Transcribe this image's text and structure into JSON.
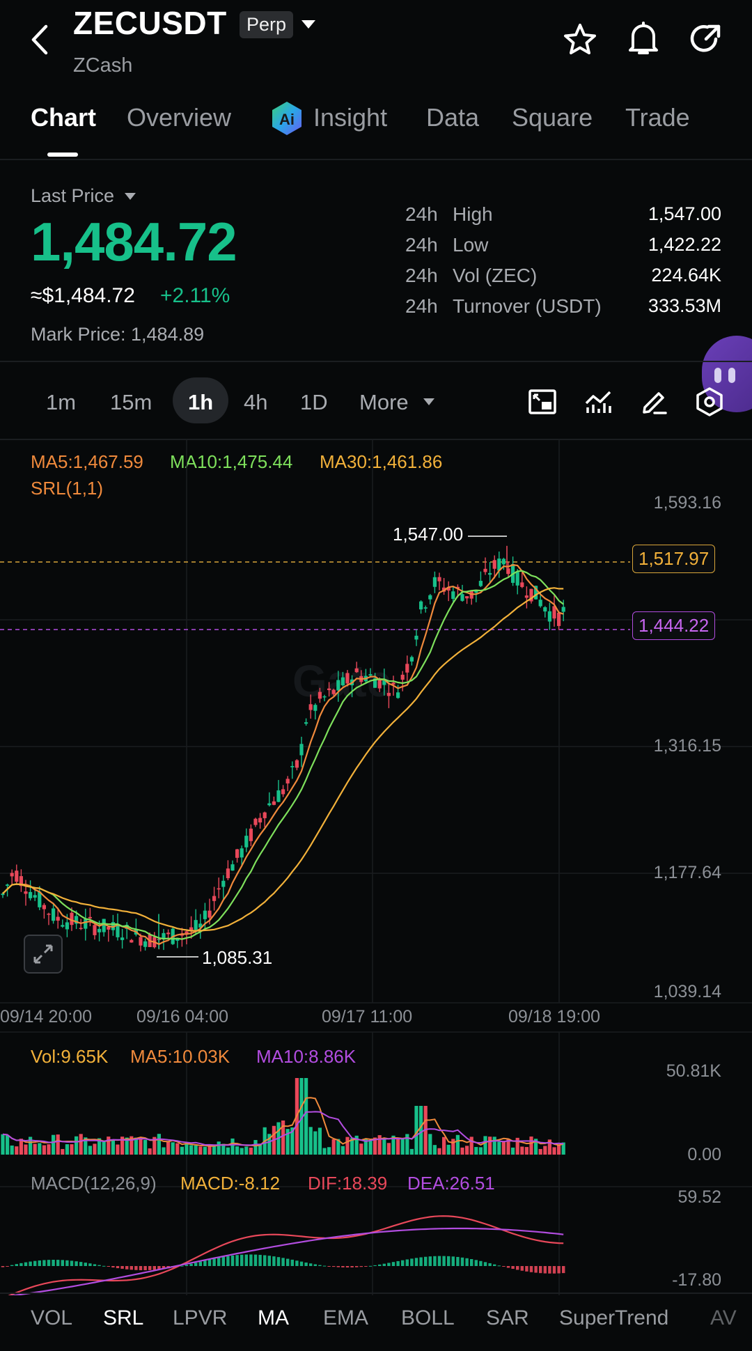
{
  "header": {
    "symbol": "ZECUSDT",
    "badge": "Perp",
    "subtitle": "ZCash"
  },
  "tabs": [
    {
      "label": "Chart"
    },
    {
      "label": "Overview"
    },
    {
      "label": "Insight"
    },
    {
      "label": "Data"
    },
    {
      "label": "Square"
    },
    {
      "label": "Trade"
    }
  ],
  "price": {
    "label": "Last Price",
    "last": "1,484.72",
    "usd": "≈$1,484.72",
    "change": "+2.11%",
    "mark": "Mark Price: 1,484.89",
    "accent": "#17c08a"
  },
  "stats": [
    {
      "period": "24h",
      "name": "High",
      "value": "1,547.00"
    },
    {
      "period": "24h",
      "name": "Low",
      "value": "1,422.22"
    },
    {
      "period": "24h",
      "name": "Vol (ZEC)",
      "value": "224.64K"
    },
    {
      "period": "24h",
      "name": "Turnover (USDT)",
      "value": "333.53M"
    }
  ],
  "timeframes": [
    {
      "label": "1m"
    },
    {
      "label": "15m"
    },
    {
      "label": "1h"
    },
    {
      "label": "4h"
    },
    {
      "label": "1D"
    },
    {
      "label": "More"
    }
  ],
  "indicators": {
    "ma5": "MA5:1,467.59",
    "ma10": "MA10:1,475.44",
    "ma30": "MA30:1,461.86",
    "srl": "SRL(1,1)"
  },
  "price_axis": [
    "1,593.16",
    "1,316.15",
    "1,177.64",
    "1,039.14"
  ],
  "price_lines": {
    "upper": "1,517.97",
    "lower": "1,444.22"
  },
  "annotations": {
    "high": "1,547.00",
    "low": "1,085.31"
  },
  "time_axis": [
    "09/14 20:00",
    "09/16 04:00",
    "09/17 11:00",
    "09/18 19:00"
  ],
  "volume": {
    "vol": "Vol:9.65K",
    "ma5": "MA5:10.03K",
    "ma10": "MA10:8.86K",
    "axis_top": "50.81K",
    "axis_bottom": "0.00"
  },
  "macd": {
    "name": "MACD(12,26,9)",
    "macd": "MACD:-8.12",
    "dif": "DIF:18.39",
    "dea": "DEA:26.51",
    "axis_top": "59.52",
    "axis_bottom": "-17.80"
  },
  "bottom_tabs": [
    {
      "label": "VOL"
    },
    {
      "label": "SRL"
    },
    {
      "label": "LPVR"
    },
    {
      "label": "MA"
    },
    {
      "label": "EMA"
    },
    {
      "label": "BOLL"
    },
    {
      "label": "SAR"
    },
    {
      "label": "SuperTrend"
    },
    {
      "label": "AV"
    }
  ],
  "colors": {
    "up": "#17c08a",
    "down": "#e8485a",
    "ma5": "#f08a3c",
    "ma10": "#7ee05c",
    "ma30": "#f2b13a",
    "purple": "#b24de0"
  }
}
